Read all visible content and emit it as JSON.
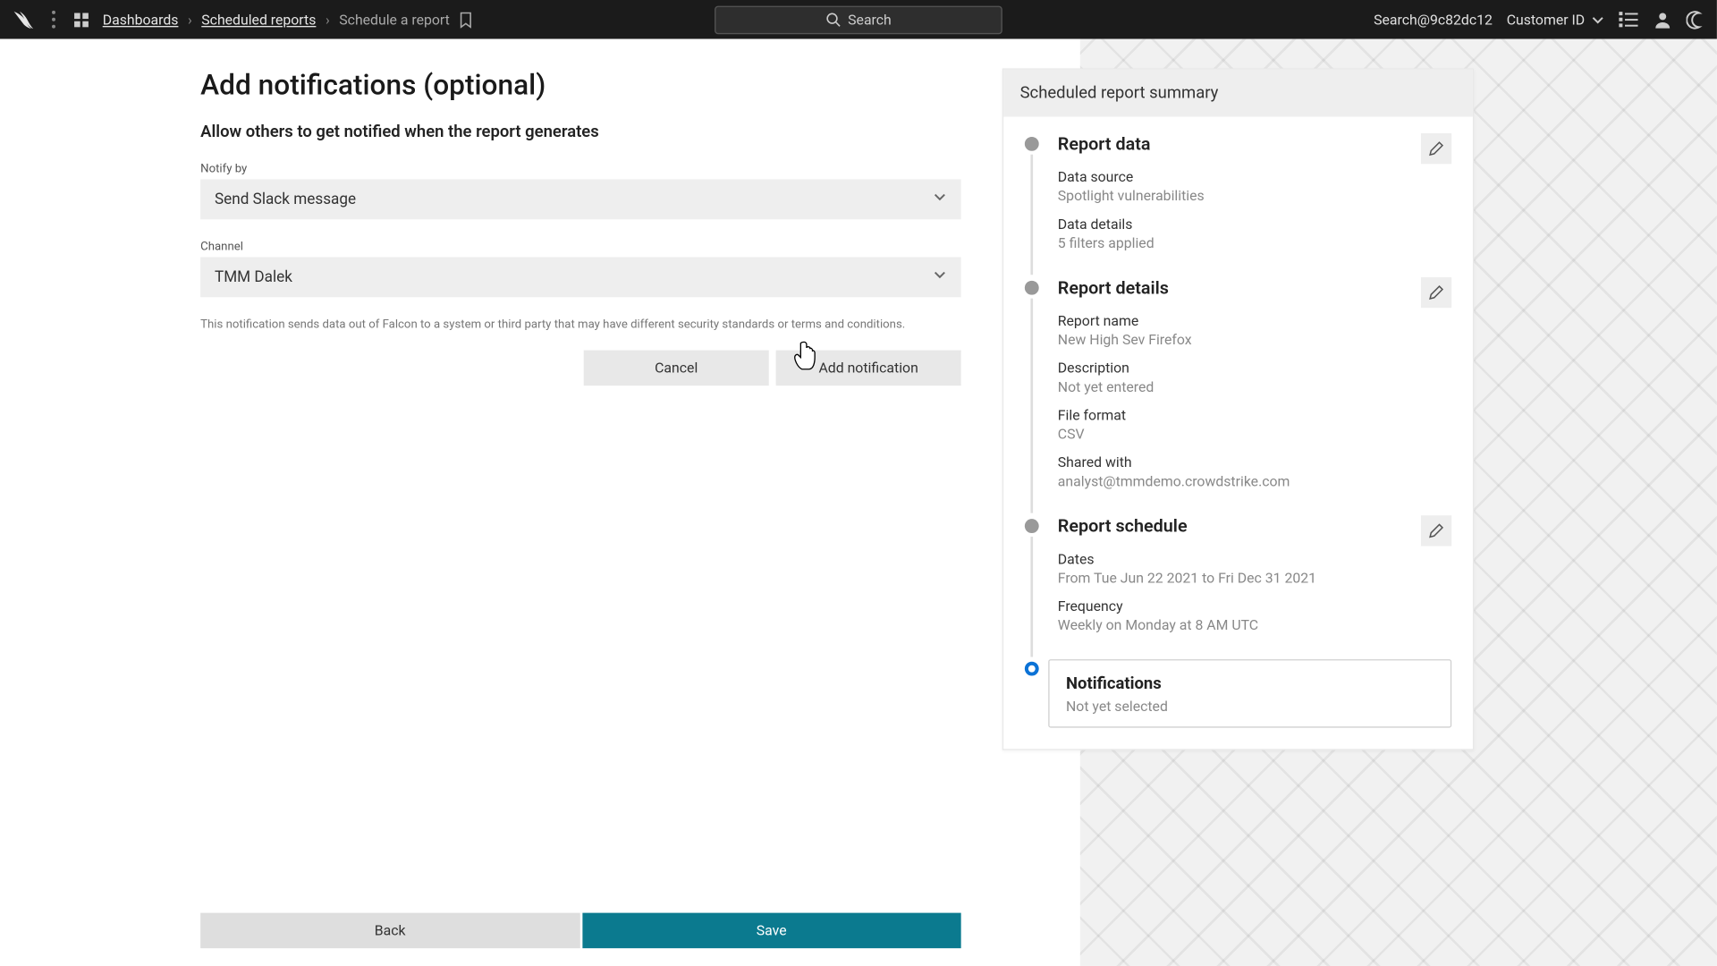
{
  "topbar": {
    "breadcrumbs": {
      "dashboards": "Dashboards",
      "scheduled": "Scheduled reports",
      "current": "Schedule a report"
    },
    "search_placeholder": "Search",
    "right": {
      "search_id": "Search@9c82dc12",
      "customer_id_label": "Customer ID"
    }
  },
  "form": {
    "title": "Add notifications (optional)",
    "subtitle": "Allow others to get notified when the report generates",
    "notify_by_label": "Notify by",
    "notify_by_value": "Send Slack message",
    "channel_label": "Channel",
    "channel_value": "TMM Dalek",
    "disclaimer": "This notification sends data out of Falcon to a system or third party that may have different security standards or terms and conditions.",
    "cancel_label": "Cancel",
    "add_label": "Add notification"
  },
  "footer": {
    "back": "Back",
    "save": "Save"
  },
  "summary": {
    "header": "Scheduled report summary",
    "report_data": {
      "title": "Report data",
      "data_source_label": "Data source",
      "data_source_value": "Spotlight vulnerabilities",
      "data_details_label": "Data details",
      "data_details_value": "5 filters applied"
    },
    "report_details": {
      "title": "Report details",
      "name_label": "Report name",
      "name_value": "New High Sev Firefox",
      "desc_label": "Description",
      "desc_value": "Not yet entered",
      "format_label": "File format",
      "format_value": "CSV",
      "shared_label": "Shared with",
      "shared_value": "analyst@tmmdemo.crowdstrike.com"
    },
    "report_schedule": {
      "title": "Report schedule",
      "dates_label": "Dates",
      "dates_value": "From Tue Jun 22 2021 to Fri Dec 31 2021",
      "freq_label": "Frequency",
      "freq_value": "Weekly on Monday at 8 AM UTC"
    },
    "notifications": {
      "title": "Notifications",
      "value": "Not yet selected"
    }
  }
}
